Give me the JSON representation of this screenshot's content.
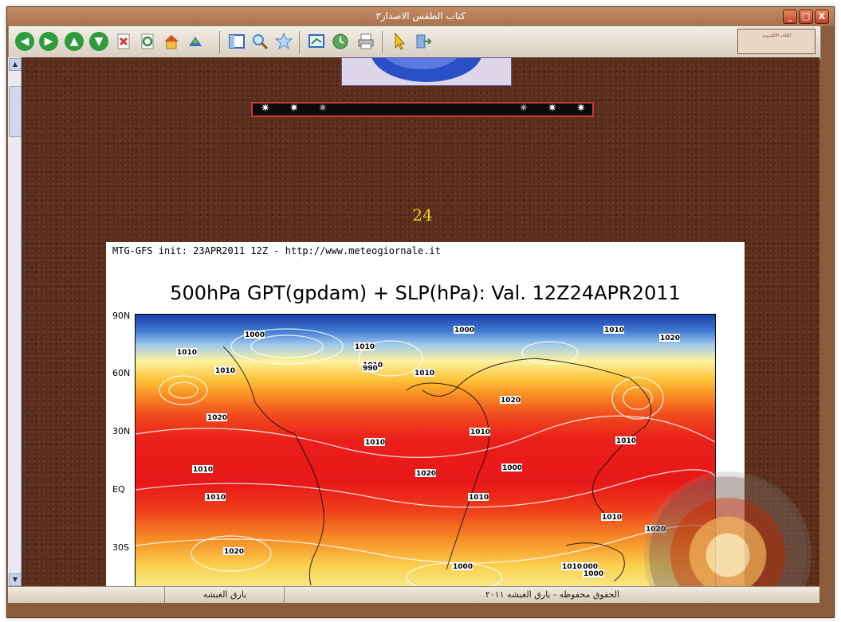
{
  "window": {
    "title": "كتاب الطقس الاصدار٣",
    "controls": {
      "minimize": "_",
      "maximize": "□",
      "close": "X"
    }
  },
  "toolbar": {
    "buttons": [
      {
        "name": "back-icon",
        "color": "#2e9b3c"
      },
      {
        "name": "forward-icon",
        "color": "#2e9b3c"
      },
      {
        "name": "up-icon",
        "color": "#2e9b3c"
      },
      {
        "name": "down-icon",
        "color": "#2e9b3c"
      },
      {
        "name": "stop-icon",
        "color": "#d43a2a"
      },
      {
        "name": "refresh-icon",
        "color": "#2c8f3e"
      },
      {
        "name": "home-icon",
        "color": "#e2a11d"
      },
      {
        "name": "tools-icon",
        "color": "#3b6fb8"
      },
      {
        "name": "contents-icon",
        "color": "#2f68b6"
      },
      {
        "name": "search-icon",
        "color": "#4a86c6"
      },
      {
        "name": "favorites-icon",
        "color": "#4a86c6"
      },
      {
        "name": "fullscreen-icon",
        "color": "#2f68b6"
      },
      {
        "name": "history-icon",
        "color": "#3a8a4a"
      },
      {
        "name": "print-icon",
        "color": "#7a7a7a"
      },
      {
        "name": "pointer-icon",
        "color": "#e0b010"
      },
      {
        "name": "exit-icon",
        "color": "#3b6fb8"
      }
    ],
    "logo_text": "الكتاب الالكتروني"
  },
  "content": {
    "page_number": "24",
    "chart_subtitle": "MTG-GFS init: 23APR2011 12Z  -  http://www.meteogiornale.it",
    "chart_title": "500hPa GPT(gpdam) + SLP(hPa): Val. 12Z24APR2011"
  },
  "chart_data": {
    "type": "heatmap",
    "title": "500hPa GPT(gpdam) + SLP(hPa): Val. 12Z24APR2011",
    "subtitle": "MTG-GFS init: 23APR2011 12Z  -  http://www.meteogiornale.it",
    "y_tick_labels": [
      "90N",
      "60N",
      "30N",
      "EQ",
      "30S"
    ],
    "isobar_labels": [
      "1000",
      "1010",
      "1010",
      "1010",
      "1000",
      "1010",
      "1020",
      "1010",
      "1020",
      "1010",
      "1020",
      "1010",
      "1010",
      "1010",
      "1010",
      "1010",
      "1020",
      "1010",
      "1010",
      "1000",
      "1000",
      "1020",
      "1000",
      "1010",
      "1020",
      "990",
      "1000"
    ]
  },
  "statusbar": {
    "left": "",
    "middle": "بارق الغبشه",
    "right": "الحقوق محفوظه - بارق الغبشه ٢٠١١"
  }
}
